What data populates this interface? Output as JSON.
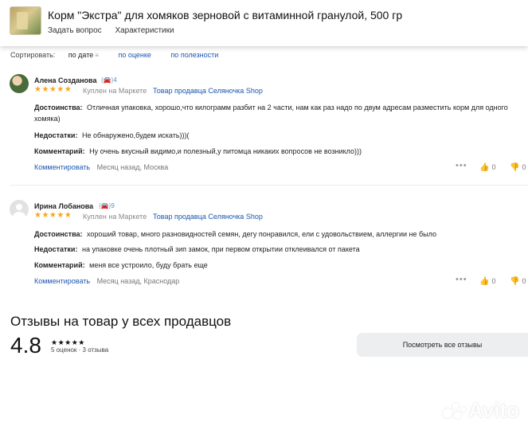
{
  "header": {
    "title": "Корм \"Экстра\" для хомяков зерновой с витаминной гранулой, 500 гр",
    "links": [
      "Задать вопрос",
      "Характеристики"
    ]
  },
  "sort": {
    "label": "Сортировать:",
    "options": [
      "по дате",
      "по оценке",
      "по полезности"
    ]
  },
  "reviews": [
    {
      "author": "Алена Созданова",
      "badge_count": "4",
      "stars": "★★★★★",
      "bought": "Куплен на Маркете",
      "seller": "Товар продавца Селяночка Shop",
      "pros_label": "Достоинства:",
      "pros": "Отличная упаковка, хорошо,что килограмм разбит на 2 части, нам как раз надо по двум адресам разместить корм для одного хомяка)",
      "cons_label": "Недостатки:",
      "cons": "Не обнаружено,будем искать)))(",
      "comment_label": "Комментарий:",
      "comment": "Ну очень вкусный видимо,и полезный,у питомца никаких вопросов не возникло)))",
      "comment_link": "Комментировать",
      "meta": "Месяц назад, Москва",
      "likes": "0",
      "dislikes": "0"
    },
    {
      "author": "Ирина Лобанова",
      "badge_count": "9",
      "stars": "★★★★★",
      "bought": "Куплен на Маркете",
      "seller": "Товар продавца Селяночка Shop",
      "pros_label": "Достоинства:",
      "pros": "хороший товар, много разновидностей семян, дегу понравился, ели с удовольствием, аллергии не было",
      "cons_label": "Недостатки:",
      "cons": "на упаковке очень плотный зип замок, при первом открытии отклеивался от пакета",
      "comment_label": "Комментарий:",
      "comment": "меня все устроило, буду брать еще",
      "comment_link": "Комментировать",
      "meta": "Месяц назад, Краснодар",
      "likes": "0",
      "dislikes": "0"
    }
  ],
  "summary": {
    "title": "Отзывы на товар у всех продавцов",
    "rating": "4.8",
    "stars": "★★★★★",
    "counts": "5 оценок · 3 отзыва",
    "button": "Посмотреть все отзывы"
  },
  "watermark": "Avito",
  "colors": {
    "link": "#1a56b0",
    "star": "#f5a623",
    "button_bg": "#eceef0"
  }
}
